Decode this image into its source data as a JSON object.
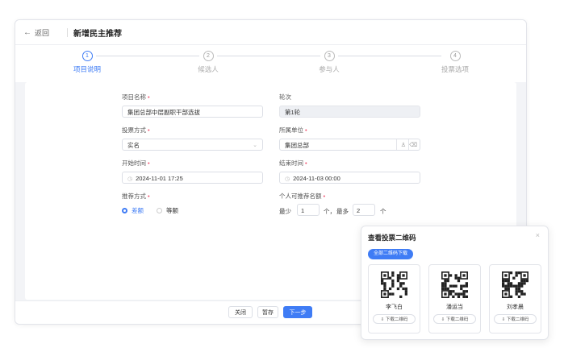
{
  "header": {
    "back_label": "返回",
    "title": "新增民主推荐"
  },
  "steps": [
    {
      "num": "1",
      "label": "项目说明",
      "active": true
    },
    {
      "num": "2",
      "label": "候选人",
      "active": false
    },
    {
      "num": "3",
      "label": "参与人",
      "active": false
    },
    {
      "num": "4",
      "label": "投票选项",
      "active": false
    }
  ],
  "form": {
    "project_name": {
      "label": "项目名称",
      "value": "集团总部中层副职干部选拔"
    },
    "round": {
      "label": "轮次",
      "value": "第1轮"
    },
    "vote_method": {
      "label": "投票方式",
      "value": "实名"
    },
    "unit": {
      "label": "所属单位",
      "value": "集团总部"
    },
    "start_time": {
      "label": "开始时间",
      "value": "2024-11-01 17:25"
    },
    "end_time": {
      "label": "结束时间",
      "value": "2024-11-03 00:00"
    },
    "recommend_method": {
      "label": "推荐方式",
      "options": [
        "差额",
        "等额"
      ],
      "selected": "差额"
    },
    "quota": {
      "label": "个人可推荐名额",
      "min_label": "最少",
      "min_value": "1",
      "unit1": "个，",
      "max_label": "最多",
      "max_value": "2",
      "unit2": "个"
    }
  },
  "footer": {
    "close_label": "关闭",
    "save_label": "暂存",
    "next_label": "下一步"
  },
  "modal": {
    "title": "查看投票二维码",
    "close": "×",
    "download_all_label": "全部二维码下载",
    "cards": [
      {
        "name": "李飞白",
        "button_label": "下载二维码"
      },
      {
        "name": "潘运当",
        "button_label": "下载二维码"
      },
      {
        "name": "刘孝晨",
        "button_label": "下载二维码"
      }
    ]
  },
  "colors": {
    "accent": "#3f7cf5",
    "required": "#f0506e"
  },
  "icons": {
    "back": "arrow-left-icon",
    "calendar": "calendar-icon",
    "user": "user-icon",
    "delete": "trash-icon",
    "download": "download-icon"
  }
}
